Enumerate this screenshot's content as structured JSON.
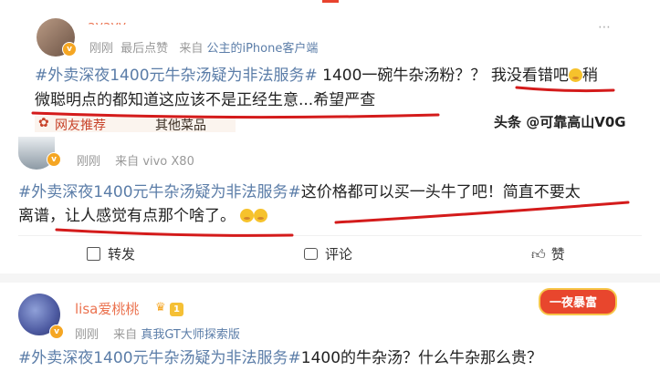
{
  "colors": {
    "accent": "#e8432e",
    "link": "#5b7da8",
    "underline": "#d41b1b"
  },
  "post1": {
    "username": "ayayy",
    "meta": {
      "time": "刚刚",
      "extra": "最后点赞",
      "from": "来自",
      "device": "公主的iPhone客户端"
    },
    "hashtag": "#外卖深夜1400元牛杂汤疑为非法服务#",
    "text_a": " 1400一碗牛杂汤粉？？",
    "text_b": "我没看错吧",
    "text_c": "稍",
    "line2": "微聪明点的都知道这应该不是正经生意...希望严查",
    "promo_a": "网友推荐",
    "promo_b": "其他菜品"
  },
  "watermark": "头条 @可靠高山V0G",
  "post2": {
    "meta": {
      "time": "刚刚",
      "from": "来自",
      "device": "vivo X80"
    },
    "hashtag": "#外卖深夜1400元牛杂汤疑为非法服务#",
    "text_a": "这价格都可以买一头牛了吧！简直不要太",
    "line2": "离谱，让人感觉有点那个啥了。",
    "actions": {
      "repost": "转发",
      "comment": "评论",
      "like": "赞"
    }
  },
  "post3": {
    "username": "lisa爱桃桃",
    "level": "1",
    "banner": "一夜暴富",
    "meta": {
      "time": "刚刚",
      "from": "来自",
      "device": "真我GT大师探索版"
    },
    "hashtag": "#外卖深夜1400元牛杂汤疑为非法服务#",
    "text_a": "1400的牛杂汤？什么牛杂那么贵？"
  }
}
